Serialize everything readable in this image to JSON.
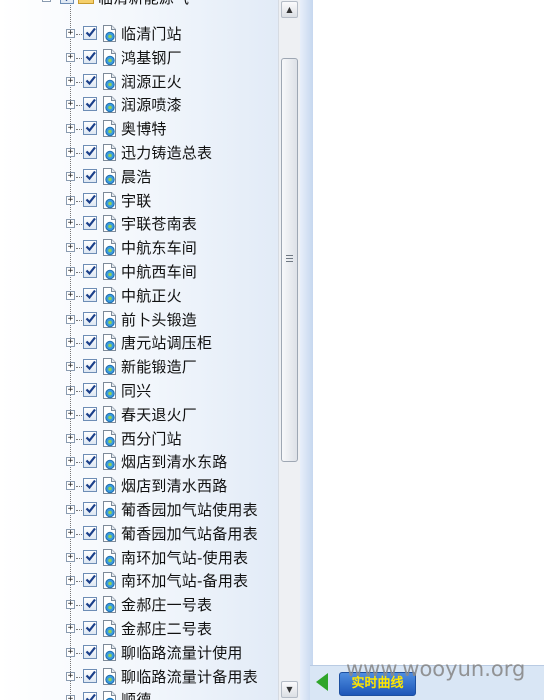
{
  "tree": {
    "parent_label": "临清新能源气",
    "items": [
      "临清门站",
      "鸿基钢厂",
      "润源正火",
      "润源喷漆",
      "奥博特",
      "迅力铸造总表",
      "晨浩",
      "宇联",
      "宇联苍南表",
      "中航东车间",
      "中航西车间",
      "中航正火",
      "前卜头锻造",
      "唐元站调压柜",
      "新能锻造厂",
      "同兴",
      "春天退火厂",
      "西分门站",
      "烟店到清水东路",
      "烟店到清水西路",
      "葡香园加气站使用表",
      "葡香园加气站备用表",
      "南环加气站-使用表",
      "南环加气站-备用表",
      "金郝庄一号表",
      "金郝庄二号表",
      "聊临路流量计使用",
      "聊临路流量计备用表",
      "顺德"
    ]
  },
  "toolbar": {
    "curve_button_label": "实时曲线"
  },
  "watermark": "www.wooyun.org",
  "colors": {
    "accent": "#1d56b8",
    "button_text": "#ffe600",
    "check": "#1a3f8a",
    "bottom_bar": "#d9e6f5"
  }
}
